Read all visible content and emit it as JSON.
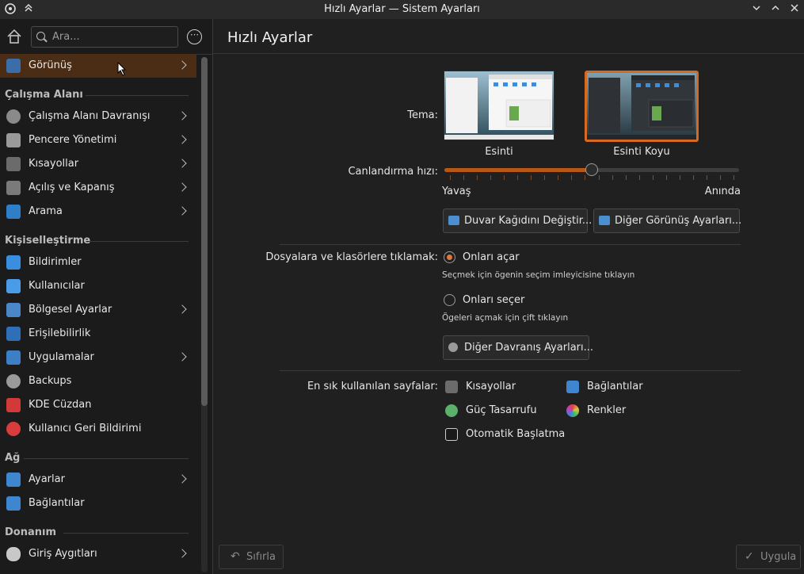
{
  "window": {
    "title": "Hızlı Ayarlar — Sistem Ayarları"
  },
  "sidebar": {
    "search_placeholder": "Ara...",
    "active_item": {
      "label": "Görünüş",
      "has_chevron": true
    },
    "sections": [
      {
        "title": "Çalışma Alanı",
        "items": [
          {
            "label": "Çalışma Alanı Davranışı",
            "has_chevron": true
          },
          {
            "label": "Pencere Yönetimi",
            "has_chevron": true
          },
          {
            "label": "Kısayollar",
            "has_chevron": true
          },
          {
            "label": "Açılış ve Kapanış",
            "has_chevron": true
          },
          {
            "label": "Arama",
            "has_chevron": true
          }
        ]
      },
      {
        "title": "Kişiselleştirme",
        "items": [
          {
            "label": "Bildirimler",
            "has_chevron": false
          },
          {
            "label": "Kullanıcılar",
            "has_chevron": false
          },
          {
            "label": "Bölgesel Ayarlar",
            "has_chevron": true
          },
          {
            "label": "Erişilebilirlik",
            "has_chevron": false
          },
          {
            "label": "Uygulamalar",
            "has_chevron": true
          },
          {
            "label": "Backups",
            "has_chevron": false
          },
          {
            "label": "KDE Cüzdan",
            "has_chevron": false
          },
          {
            "label": "Kullanıcı Geri Bildirimi",
            "has_chevron": false
          }
        ]
      },
      {
        "title": "Ağ",
        "items": [
          {
            "label": "Ayarlar",
            "has_chevron": true
          },
          {
            "label": "Bağlantılar",
            "has_chevron": false
          }
        ]
      },
      {
        "title": "Donanım",
        "items": [
          {
            "label": "Giriş Aygıtları",
            "has_chevron": true
          }
        ]
      }
    ]
  },
  "main": {
    "page_title": "Hızlı Ayarlar",
    "theme": {
      "label": "Tema:",
      "options": [
        {
          "name": "Esinti",
          "selected": false
        },
        {
          "name": "Esinti Koyu",
          "selected": true
        }
      ]
    },
    "animation": {
      "label": "Canlandırma hızı:",
      "min_label": "Yavaş",
      "max_label": "Anında",
      "value_fraction": 0.5,
      "tick_count": 22
    },
    "wallpaper_button": "Duvar Kağıdını Değiştir...",
    "more_appearance_button": "Diğer Görünüş Ayarları...",
    "click_behavior": {
      "label": "Dosyalara ve klasörlere tıklamak:",
      "open_label": "Onları açar",
      "open_hint": "Seçmek için ögenin seçim imleyicisine tıklayın",
      "select_label": "Onları seçer",
      "select_hint": "Ögeleri açmak için çift tıklayın",
      "selected": "open"
    },
    "more_behavior_button": "Diğer Davranış Ayarları...",
    "frequent": {
      "label": "En sık kullanılan sayfalar:",
      "items": [
        "Kısayollar",
        "Bağlantılar",
        "Güç Tasarrufu",
        "Renkler",
        "Otomatik Başlatma"
      ]
    }
  },
  "footer": {
    "reset_button": "Sıfırla",
    "apply_button": "Uygula"
  },
  "colors": {
    "accent": "#e0783a",
    "selection": "#4a2d14",
    "background": "#202020"
  }
}
